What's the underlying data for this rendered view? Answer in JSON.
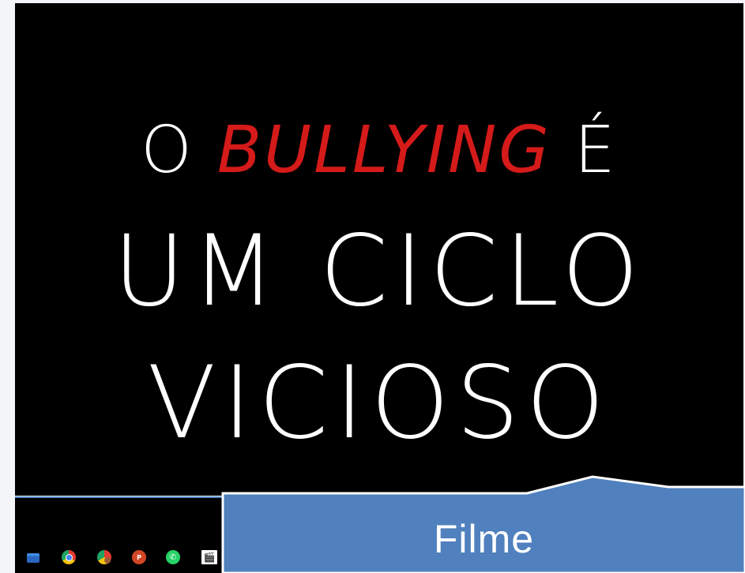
{
  "video": {
    "line1_before": "O ",
    "line1_accent": "BULLYING",
    "line1_after": " É",
    "line2": "UM CICLO",
    "line3": "VICIOSO",
    "accent_color": "#d51a1a",
    "text_color": "#ffffff",
    "background_color": "#000000"
  },
  "taskbar": {
    "icons": [
      {
        "name": "file-explorer-icon",
        "glyph": ""
      },
      {
        "name": "chrome-icon",
        "glyph": ""
      },
      {
        "name": "chrome-profile-icon",
        "glyph": ""
      },
      {
        "name": "powerpoint-icon",
        "glyph": "P"
      },
      {
        "name": "whatsapp-icon",
        "glyph": "✆"
      },
      {
        "name": "video-editor-icon",
        "glyph": "🎬"
      }
    ]
  },
  "callout": {
    "label": "Filme",
    "fill_color": "#5080bd",
    "border_color": "#ffffff"
  }
}
